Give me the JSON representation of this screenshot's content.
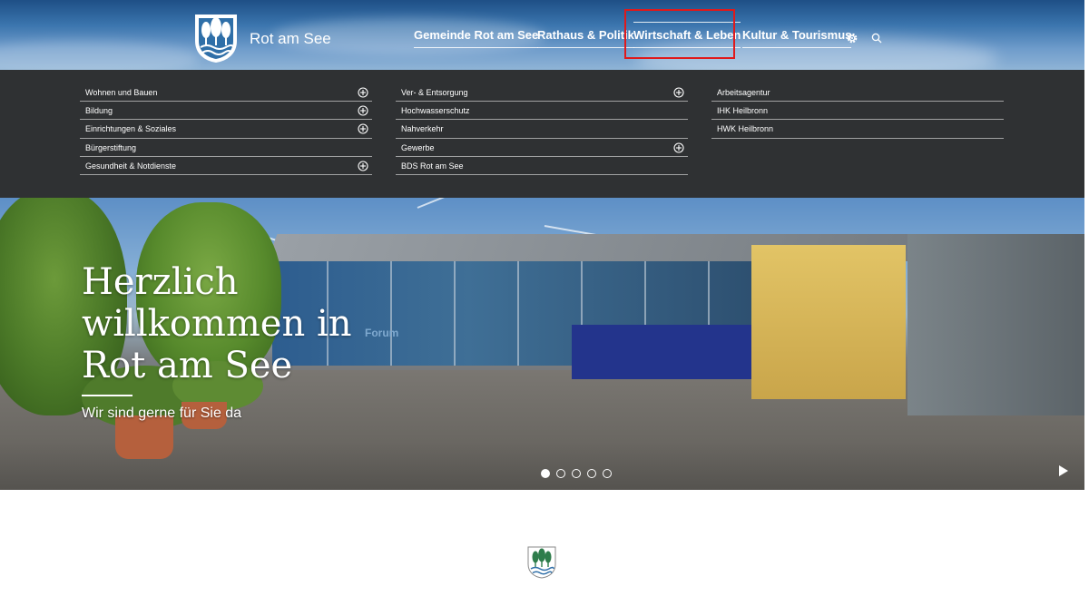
{
  "header": {
    "site_name": "Rot am See",
    "nav": [
      {
        "label": "Gemeinde Rot am See",
        "active": false
      },
      {
        "label": "Rathaus & Politik",
        "active": false
      },
      {
        "label": "Wirtschaft & Leben",
        "active": true
      },
      {
        "label": "Kultur & Tourismus",
        "active": false
      }
    ],
    "settings_icon": "gear-icon",
    "search_icon": "search-icon"
  },
  "mega_menu": {
    "columns": [
      [
        {
          "label": "Wohnen und Bauen",
          "expandable": true
        },
        {
          "label": "Bildung",
          "expandable": true
        },
        {
          "label": "Einrichtungen & Soziales",
          "expandable": true
        },
        {
          "label": "Bürgerstiftung",
          "expandable": false
        },
        {
          "label": "Gesundheit & Notdienste",
          "expandable": true
        }
      ],
      [
        {
          "label": "Ver- & Entsorgung",
          "expandable": true
        },
        {
          "label": "Hochwasserschutz",
          "expandable": false
        },
        {
          "label": "Nahverkehr",
          "expandable": false
        },
        {
          "label": "Gewerbe",
          "expandable": true
        },
        {
          "label": "BDS Rot am See",
          "expandable": false
        }
      ],
      [
        {
          "label": "Arbeitsagentur",
          "expandable": false
        },
        {
          "label": "IHK Heilbronn",
          "expandable": false
        },
        {
          "label": "HWK Heilbronn",
          "expandable": false
        }
      ]
    ]
  },
  "hero": {
    "title": "Herzlich\nwillkommen in\nRot am See",
    "subtitle": "Wir sind gerne für Sie da",
    "building_sign": "Forum",
    "slides": 5,
    "active_slide": 0
  },
  "colors": {
    "mega_bg": "#2f3133",
    "highlight": "#e0191b",
    "logo_green": "#2e7d4b"
  }
}
